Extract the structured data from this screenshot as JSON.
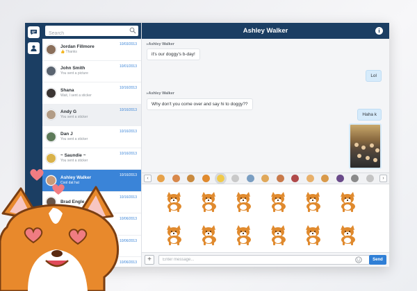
{
  "search": {
    "placeholder": "Search"
  },
  "header": {
    "title": "Ashley Walker"
  },
  "contacts": [
    {
      "name": "Jordan Fillmore",
      "sub": "👍 Thanks",
      "date": "10/03/2013",
      "avatar": "#8a6f5b",
      "state": "normal"
    },
    {
      "name": "John Smith",
      "sub": "You sent a picture",
      "date": "10/01/2013",
      "avatar": "#5a6470",
      "state": "normal"
    },
    {
      "name": "Shana",
      "sub": "Wait, I sent a sticker",
      "date": "10/16/2013",
      "avatar": "#3b3533",
      "state": "normal"
    },
    {
      "name": "Andy G",
      "sub": "You sent a sticker",
      "date": "10/16/2013",
      "avatar": "#b29c86",
      "state": "gray"
    },
    {
      "name": "Dan J",
      "sub": "You sent a sticker",
      "date": "10/16/2013",
      "avatar": "#5d7a5a",
      "state": "normal"
    },
    {
      "name": "~ Saundie ~",
      "sub": "You sent a sticker",
      "date": "10/16/2013",
      "avatar": "#d9b24a",
      "state": "normal"
    },
    {
      "name": "Ashley Walker",
      "sub": "Cool dat hat",
      "date": "10/16/2013",
      "avatar": "#c79a7a",
      "state": "active"
    },
    {
      "name": "Brad Engle",
      "sub": "",
      "date": "10/16/2013",
      "avatar": "#6a5548",
      "state": "normal"
    },
    {
      "name": "",
      "sub": "",
      "date": "10/06/2013",
      "avatar": "#9a8a7a",
      "state": "normal"
    },
    {
      "name": "",
      "sub": "",
      "date": "10/06/2013",
      "avatar": "#7a6a5a",
      "state": "normal"
    },
    {
      "name": "",
      "sub": "",
      "date": "10/06/2013",
      "avatar": "#8a7a6a",
      "state": "normal"
    }
  ],
  "messages": {
    "m1_sender": "Ashley Walker",
    "m1_text": "it's our doggy's b-day!",
    "m2_text": "Lol",
    "m3_sender": "Ashley Walker",
    "m3_text": "Why don't you come over and say hi to doggy??",
    "m4_text": "Haha k"
  },
  "input": {
    "placeholder": "Enter message..."
  },
  "buttons": {
    "send": "Send",
    "plus": "+",
    "prev": "‹",
    "next": "›",
    "info": "i"
  },
  "colors": {
    "navy": "#1b3e63",
    "accent": "#3a84d8",
    "corgi": "#e08a2e",
    "heart": "#f07c82"
  }
}
